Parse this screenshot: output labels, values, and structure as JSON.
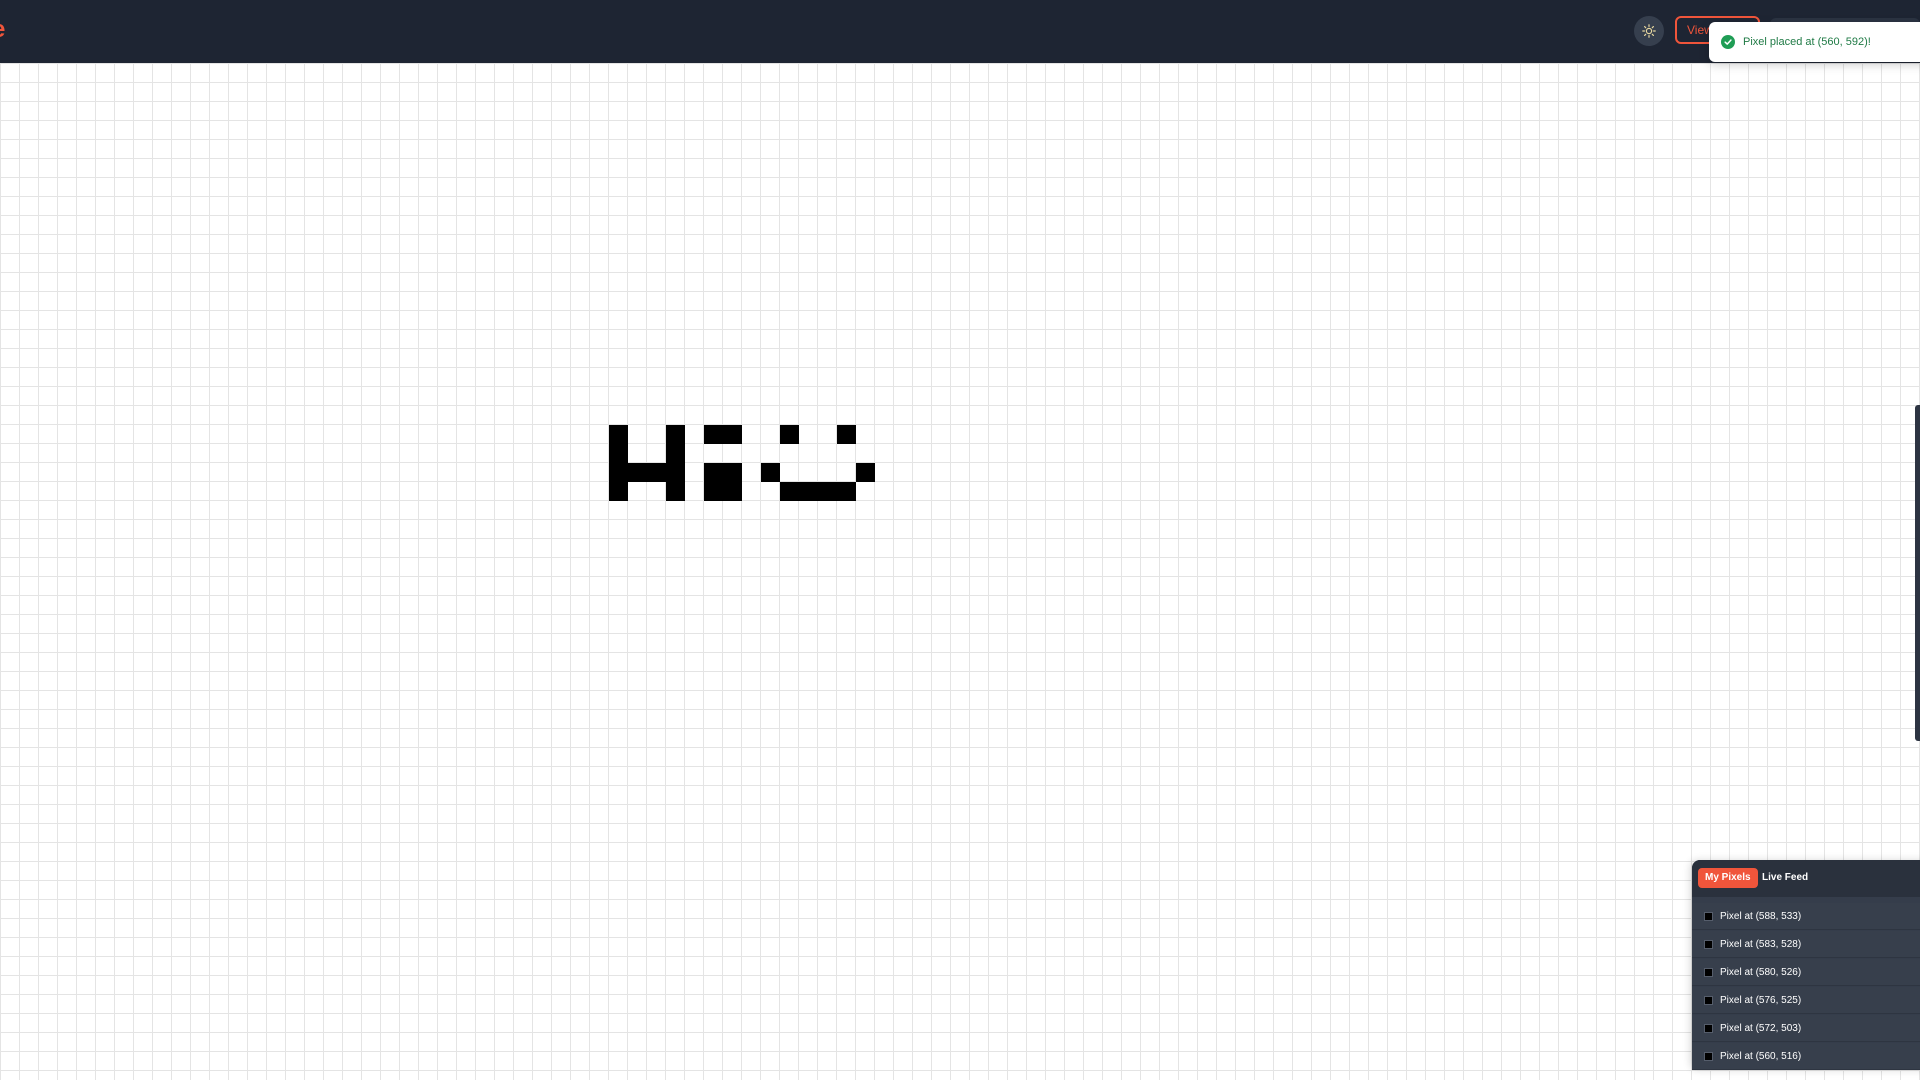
{
  "header": {
    "brand_text": "e",
    "theme_icon": "sun-icon",
    "view_button_label": "View"
  },
  "toast": {
    "icon": "check-circle-icon",
    "message": "Pixel placed at (560, 592)!",
    "color": "#1f9d55"
  },
  "canvas": {
    "pixel_color": "#000000"
  },
  "panel": {
    "tabs": [
      {
        "label": "My Pixels",
        "active": true
      },
      {
        "label": "Live Feed",
        "active": false
      }
    ],
    "items": [
      {
        "label": "Pixel at (588, 533)",
        "color": "#000000"
      },
      {
        "label": "Pixel at (583, 528)",
        "color": "#000000"
      },
      {
        "label": "Pixel at (580, 526)",
        "color": "#000000"
      },
      {
        "label": "Pixel at (576, 525)",
        "color": "#000000"
      },
      {
        "label": "Pixel at (572, 503)",
        "color": "#000000"
      },
      {
        "label": "Pixel at (560, 516)",
        "color": "#000000"
      }
    ]
  },
  "colors": {
    "accent": "#f0553b",
    "header_bg": "#1e2533",
    "panel_bg": "#353d4b"
  }
}
